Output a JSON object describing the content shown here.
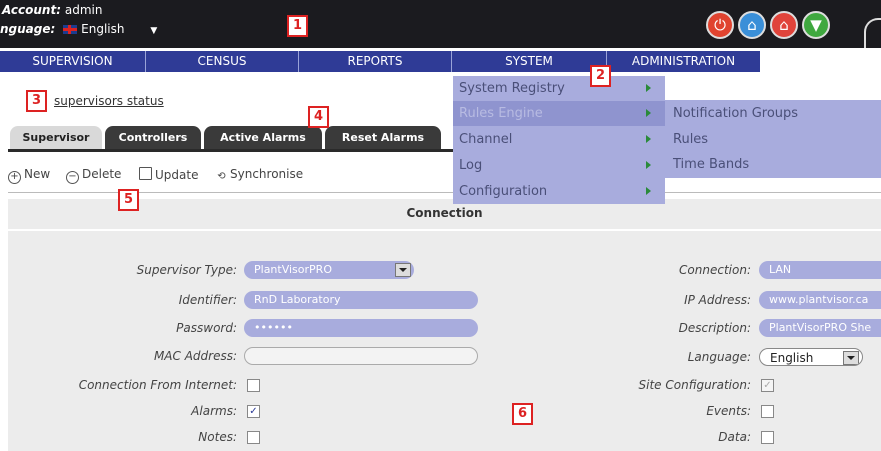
{
  "header": {
    "account_label": "Account:",
    "account_value": "admin",
    "language_label": "nguage:",
    "language_value": "English"
  },
  "markers": [
    "1",
    "2",
    "3",
    "4",
    "5",
    "6"
  ],
  "nav": [
    "SUPERVISION",
    "CENSUS",
    "REPORTS",
    "SYSTEM",
    "ADMINISTRATION"
  ],
  "system_menu": [
    {
      "label": "System Registry"
    },
    {
      "label": "Rules Engine"
    },
    {
      "label": "Channel"
    },
    {
      "label": "Log"
    },
    {
      "label": "Configuration"
    }
  ],
  "rules_submenu": [
    "Notification Groups",
    "Rules",
    "Time Bands"
  ],
  "breadcrumb": "supervisors status",
  "tabs": [
    "Supervisor",
    "Controllers",
    "Active Alarms",
    "Reset Alarms"
  ],
  "toolbar": {
    "new": "New",
    "delete": "Delete",
    "update": "Update",
    "synchronise": "Synchronise"
  },
  "section_title": "Connection",
  "form_left": {
    "supervisor_type": {
      "label": "Supervisor Type:",
      "value": "PlantVisorPRO"
    },
    "identifier": {
      "label": "Identifier:",
      "value": "RnD Laboratory"
    },
    "password": {
      "label": "Password:",
      "value": "••••••"
    },
    "mac_address": {
      "label": "MAC Address:",
      "value": ""
    },
    "connection_from_internet": {
      "label": "Connection From Internet:",
      "checked": false
    },
    "alarms": {
      "label": "Alarms:",
      "checked": true
    },
    "notes": {
      "label": "Notes:",
      "checked": false
    }
  },
  "form_right": {
    "connection": {
      "label": "Connection:",
      "value": "LAN"
    },
    "ip_address": {
      "label": "IP Address:",
      "value": "www.plantvisor.ca"
    },
    "description": {
      "label": "Description:",
      "value": "PlantVisorPRO She"
    },
    "language": {
      "label": "Language:",
      "value": "English"
    },
    "site_configuration": {
      "label": "Site Configuration:",
      "checked": true
    },
    "events": {
      "label": "Events:",
      "checked": false
    },
    "data": {
      "label": "Data:",
      "checked": false
    }
  },
  "colors": {
    "nav": "#2f3b96",
    "menu": "#a8acdd",
    "topbar": "#1b1b1f",
    "marker": "#dd2222"
  }
}
